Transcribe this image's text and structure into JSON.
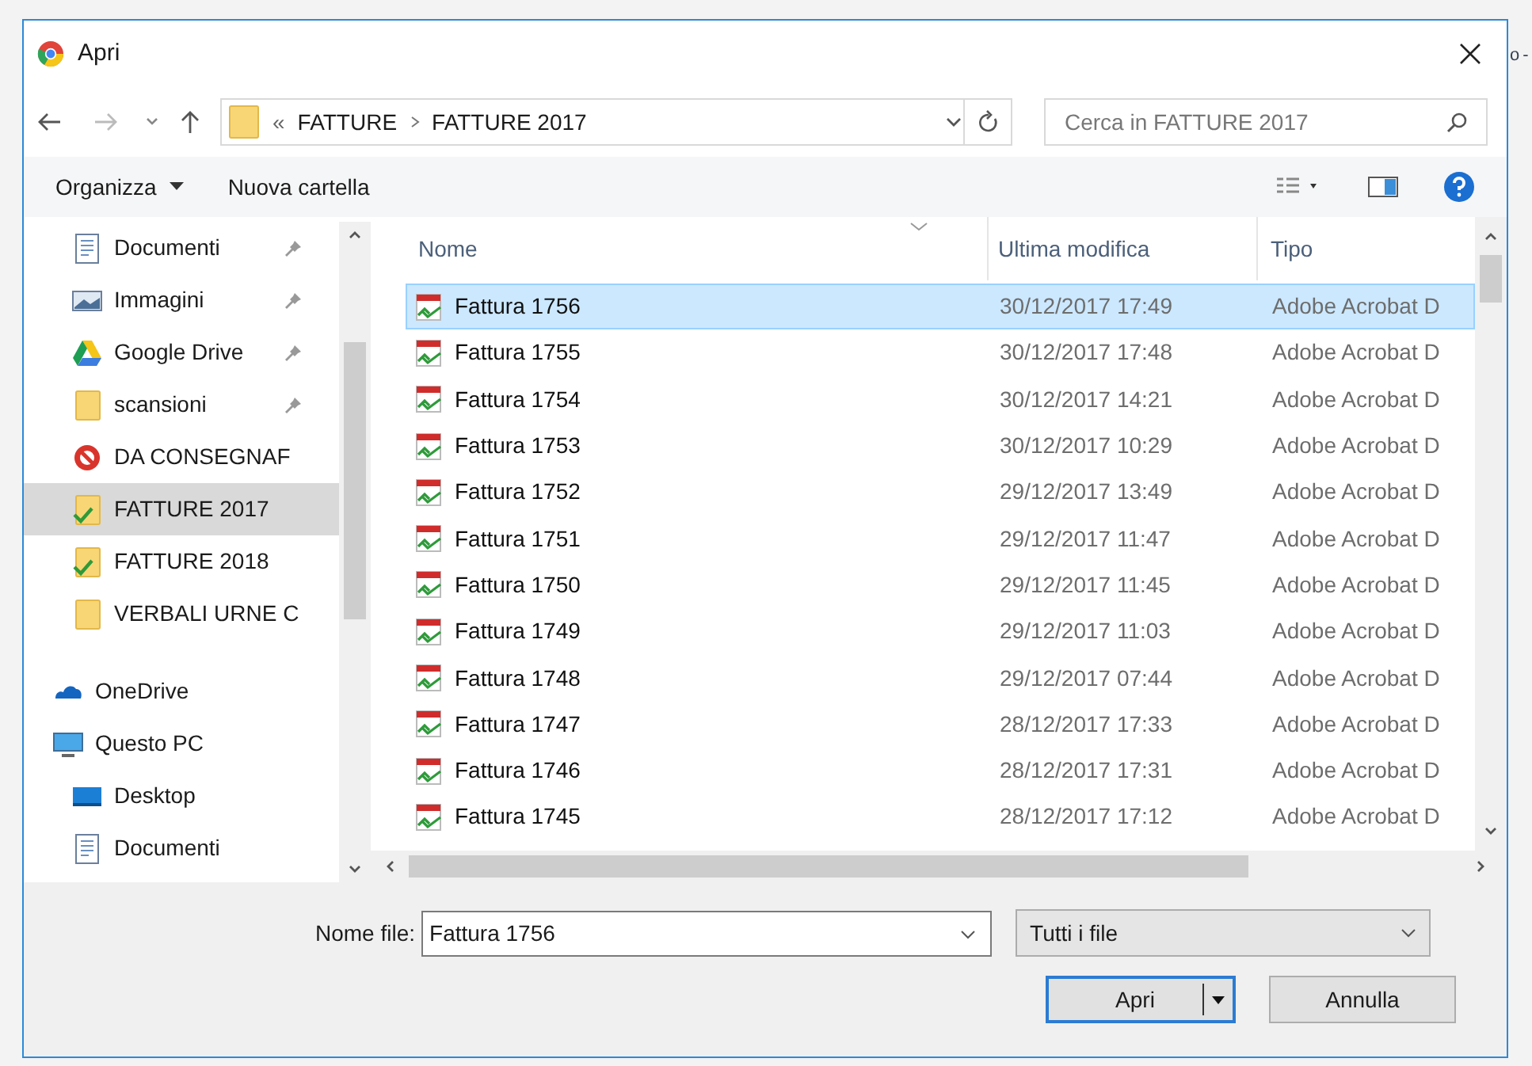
{
  "behind_window_text": "o -",
  "window": {
    "title": "Apri"
  },
  "nav": {
    "breadcrumb": [
      {
        "label": "«",
        "kind": "overflow"
      },
      {
        "label": "FATTURE",
        "kind": "folder"
      },
      {
        "label": "FATTURE 2017",
        "kind": "folder"
      }
    ],
    "search": {
      "placeholder": "Cerca in FATTURE 2017"
    }
  },
  "toolbar": {
    "organize": "Organizza",
    "new_folder": "Nuova cartella"
  },
  "sidebar": {
    "items": [
      {
        "label": "Documenti",
        "kind": "document",
        "pinned": true,
        "selected": false
      },
      {
        "label": "Immagini",
        "kind": "image",
        "pinned": true,
        "selected": false
      },
      {
        "label": "Google Drive",
        "kind": "drive",
        "pinned": true,
        "selected": false
      },
      {
        "label": "scansioni",
        "kind": "folder",
        "pinned": true,
        "selected": false
      },
      {
        "label": "DA CONSEGNAF",
        "kind": "blocked",
        "pinned": false,
        "selected": false
      },
      {
        "label": "FATTURE 2017",
        "kind": "synced",
        "pinned": false,
        "selected": true
      },
      {
        "label": "FATTURE 2018",
        "kind": "synced",
        "pinned": false,
        "selected": false
      },
      {
        "label": "VERBALI URNE C",
        "kind": "folder",
        "pinned": false,
        "selected": false
      },
      {
        "label": "OneDrive",
        "kind": "cloud",
        "pinned": false,
        "selected": false
      },
      {
        "label": "Questo PC",
        "kind": "pc",
        "pinned": false,
        "selected": false
      },
      {
        "label": "Desktop",
        "kind": "desktop",
        "pinned": false,
        "selected": false
      },
      {
        "label": "Documenti",
        "kind": "document",
        "pinned": false,
        "selected": false
      }
    ]
  },
  "table": {
    "columns": [
      "Nome",
      "Ultima modifica",
      "Tipo"
    ],
    "rows": [
      {
        "name": "Fattura 1756",
        "modified": "30/12/2017 17:49",
        "type": "Adobe Acrobat D",
        "selected": true
      },
      {
        "name": "Fattura 1755",
        "modified": "30/12/2017 17:48",
        "type": "Adobe Acrobat D",
        "selected": false
      },
      {
        "name": "Fattura 1754",
        "modified": "30/12/2017 14:21",
        "type": "Adobe Acrobat D",
        "selected": false
      },
      {
        "name": "Fattura 1753",
        "modified": "30/12/2017 10:29",
        "type": "Adobe Acrobat D",
        "selected": false
      },
      {
        "name": "Fattura 1752",
        "modified": "29/12/2017 13:49",
        "type": "Adobe Acrobat D",
        "selected": false
      },
      {
        "name": "Fattura 1751",
        "modified": "29/12/2017 11:47",
        "type": "Adobe Acrobat D",
        "selected": false
      },
      {
        "name": "Fattura 1750",
        "modified": "29/12/2017 11:45",
        "type": "Adobe Acrobat D",
        "selected": false
      },
      {
        "name": "Fattura 1749",
        "modified": "29/12/2017 11:03",
        "type": "Adobe Acrobat D",
        "selected": false
      },
      {
        "name": "Fattura 1748",
        "modified": "29/12/2017 07:44",
        "type": "Adobe Acrobat D",
        "selected": false
      },
      {
        "name": "Fattura 1747",
        "modified": "28/12/2017 17:33",
        "type": "Adobe Acrobat D",
        "selected": false
      },
      {
        "name": "Fattura 1746",
        "modified": "28/12/2017 17:31",
        "type": "Adobe Acrobat D",
        "selected": false
      },
      {
        "name": "Fattura 1745",
        "modified": "28/12/2017 17:12",
        "type": "Adobe Acrobat D",
        "selected": false
      }
    ]
  },
  "footer": {
    "filename_label": "Nome file:",
    "filename": "Fattura 1756",
    "filter": "Tutti i file",
    "open": "Apri",
    "cancel": "Annulla"
  }
}
